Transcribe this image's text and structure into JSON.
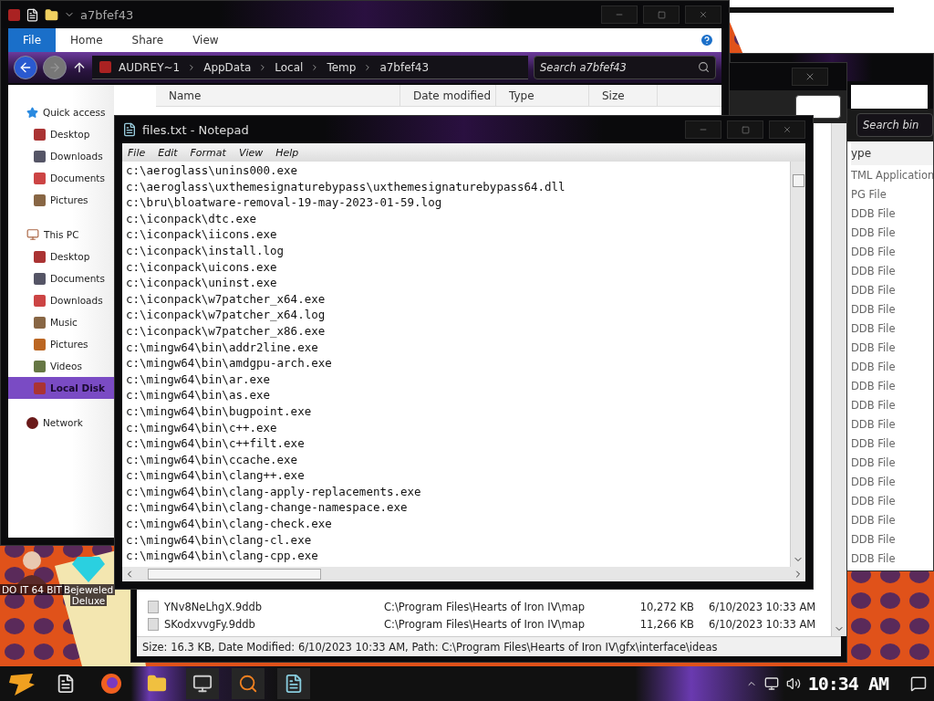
{
  "explorer": {
    "title": "a7bfef43",
    "ribbon_tabs": [
      {
        "label": "File",
        "selected": true
      },
      {
        "label": "Home",
        "selected": false
      },
      {
        "label": "Share",
        "selected": false
      },
      {
        "label": "View",
        "selected": false
      }
    ],
    "breadcrumb": [
      "AUDREY~1",
      "AppData",
      "Local",
      "Temp",
      "a7bfef43"
    ],
    "search": {
      "placeholder": "Search a7bfef43"
    },
    "columns": [
      "Name",
      "Date modified",
      "Type",
      "Size"
    ],
    "nav": [
      {
        "label": "Quick access",
        "kind": "star",
        "selected": false,
        "children": [
          {
            "label": "Desktop",
            "selected": false
          },
          {
            "label": "Downloads",
            "selected": false
          },
          {
            "label": "Documents",
            "selected": false
          },
          {
            "label": "Pictures",
            "selected": false
          }
        ]
      },
      {
        "label": "This PC",
        "kind": "pc",
        "selected": false,
        "children": [
          {
            "label": "Desktop",
            "selected": false
          },
          {
            "label": "Documents",
            "selected": false
          },
          {
            "label": "Downloads",
            "selected": false
          },
          {
            "label": "Music",
            "selected": false
          },
          {
            "label": "Pictures",
            "selected": false
          },
          {
            "label": "Videos",
            "selected": false
          },
          {
            "label": "Local Disk",
            "selected": true
          }
        ]
      },
      {
        "label": "Network",
        "kind": "network",
        "selected": false
      }
    ]
  },
  "bin_window": {
    "search": {
      "placeholder": "Search bin"
    },
    "column": "ype",
    "types": [
      "TML Application",
      "PG File",
      "DDB File",
      "DDB File",
      "DDB File",
      "DDB File",
      "DDB File",
      "DDB File",
      "DDB File",
      "DDB File",
      "DDB File",
      "DDB File",
      "DDB File",
      "DDB File",
      "DDB File",
      "DDB File",
      "DDB File",
      "DDB File",
      "DDB File",
      "DDB File",
      "DDB File"
    ]
  },
  "results_window": {
    "rows": [
      {
        "name": "YNv8NeLhgX.9ddb",
        "path": "C:\\Program Files\\Hearts of Iron IV\\map",
        "size": "10,272 KB",
        "date": "6/10/2023 10:33 AM"
      },
      {
        "name": "SKodxvvgFy.9ddb",
        "path": "C:\\Program Files\\Hearts of Iron IV\\map",
        "size": "11,266 KB",
        "date": "6/10/2023 10:33 AM"
      }
    ],
    "status": "Size: 16.3 KB, Date Modified: 6/10/2023 10:33 AM, Path: C:\\Program Files\\Hearts of Iron IV\\gfx\\interface\\ideas"
  },
  "notepad": {
    "title": "files.txt - Notepad",
    "menu": [
      "File",
      "Edit",
      "Format",
      "View",
      "Help"
    ],
    "lines": [
      "c:\\aeroglass\\unins000.exe",
      "c:\\aeroglass\\uxthemesignaturebypass\\uxthemesignaturebypass64.dll",
      "c:\\bru\\bloatware-removal-19-may-2023-01-59.log",
      "c:\\iconpack\\dtc.exe",
      "c:\\iconpack\\iicons.exe",
      "c:\\iconpack\\install.log",
      "c:\\iconpack\\uicons.exe",
      "c:\\iconpack\\uninst.exe",
      "c:\\iconpack\\w7patcher_x64.exe",
      "c:\\iconpack\\w7patcher_x64.log",
      "c:\\iconpack\\w7patcher_x86.exe",
      "c:\\mingw64\\bin\\addr2line.exe",
      "c:\\mingw64\\bin\\amdgpu-arch.exe",
      "c:\\mingw64\\bin\\ar.exe",
      "c:\\mingw64\\bin\\as.exe",
      "c:\\mingw64\\bin\\bugpoint.exe",
      "c:\\mingw64\\bin\\c++.exe",
      "c:\\mingw64\\bin\\c++filt.exe",
      "c:\\mingw64\\bin\\ccache.exe",
      "c:\\mingw64\\bin\\clang++.exe",
      "c:\\mingw64\\bin\\clang-apply-replacements.exe",
      "c:\\mingw64\\bin\\clang-change-namespace.exe",
      "c:\\mingw64\\bin\\clang-check.exe",
      "c:\\mingw64\\bin\\clang-cl.exe",
      "c:\\mingw64\\bin\\clang-cpp.exe"
    ]
  },
  "desktop_icons": [
    {
      "label": "DO IT 64 BIT",
      "kind": "figure"
    },
    {
      "label": "Bejeweled",
      "label_2": "Deluxe",
      "kind": "gem"
    }
  ],
  "taskbar": {
    "time": "10:34 AM"
  }
}
